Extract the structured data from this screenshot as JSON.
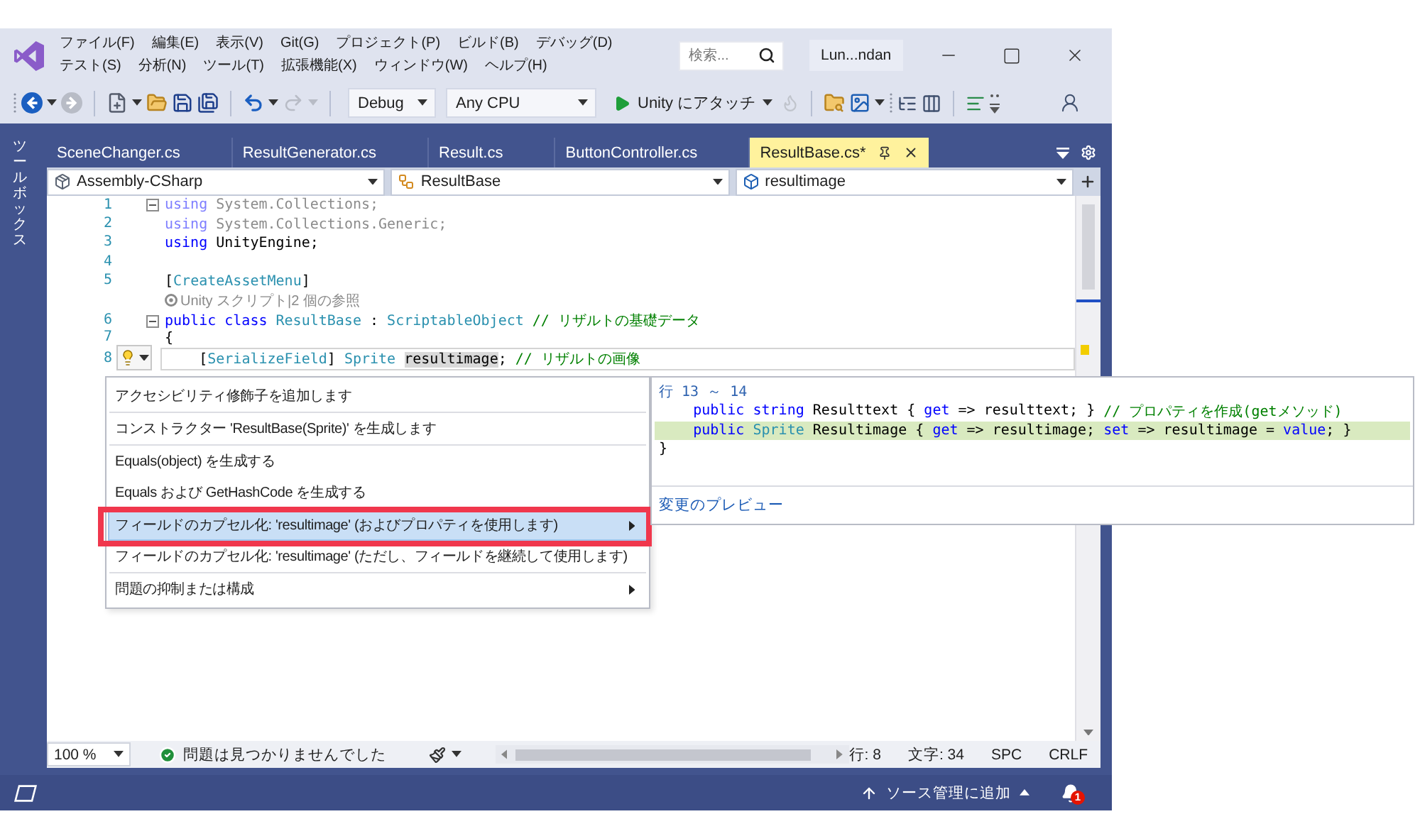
{
  "title_bar": {
    "menus": [
      [
        "ファイル(F)",
        "編集(E)",
        "表示(V)",
        "Git(G)",
        "プロジェクト(P)",
        "ビルド(B)",
        "デバッグ(D)"
      ],
      [
        "テスト(S)",
        "分析(N)",
        "ツール(T)",
        "拡張機能(X)",
        "ウィンドウ(W)",
        "ヘルプ(H)"
      ]
    ],
    "search": {
      "placeholder": "検索..."
    },
    "account": "Lun...ndan"
  },
  "toolbar": {
    "configuration": "Debug",
    "platform": "Any CPU",
    "start_label": "Unity にアタッチ"
  },
  "toolbox": {
    "label": "ツールボックス"
  },
  "tabs": [
    {
      "label": "SceneChanger.cs",
      "selected": false
    },
    {
      "label": "ResultGenerator.cs",
      "selected": false
    },
    {
      "label": "Result.cs",
      "selected": false
    },
    {
      "label": "ButtonController.cs",
      "selected": false
    },
    {
      "label": "ResultBase.cs*",
      "selected": true
    }
  ],
  "navigation_bar": [
    {
      "kind": "project",
      "label": "Assembly-CSharp"
    },
    {
      "kind": "class",
      "label": "ResultBase"
    },
    {
      "kind": "member",
      "label": "resultimage"
    }
  ],
  "editor": {
    "lines": [
      {
        "kind": "code",
        "number": "1",
        "expanded": true,
        "faded": true,
        "current": false,
        "lightbulb": false,
        "tokens": [
          {
            "kind": "keyword",
            "text": "using"
          },
          {
            "kind": "plain",
            "text": " System.Collections;"
          }
        ]
      },
      {
        "kind": "code",
        "number": "2",
        "faded": true,
        "current": false,
        "lightbulb": false,
        "tokens": [
          {
            "kind": "keyword",
            "text": "using"
          },
          {
            "kind": "plain",
            "text": " System.Collections.Generic;"
          }
        ]
      },
      {
        "kind": "code",
        "number": "3",
        "faded": false,
        "current": false,
        "lightbulb": false,
        "tokens": [
          {
            "kind": "keyword",
            "text": "using"
          },
          {
            "kind": "plain",
            "text": " UnityEngine;"
          }
        ]
      },
      {
        "kind": "code",
        "number": "4",
        "current": false,
        "lightbulb": false
      },
      {
        "kind": "code",
        "number": "5",
        "faded": false,
        "current": false,
        "lightbulb": false,
        "tokens": [
          {
            "kind": "plain",
            "text": "["
          },
          {
            "kind": "type",
            "text": "CreateAssetMenu"
          },
          {
            "kind": "plain",
            "text": "]"
          }
        ]
      },
      {
        "kind": "codelens",
        "text": "Unity スクリプト|2 個の参照"
      },
      {
        "kind": "code",
        "number": "6",
        "expanded": true,
        "faded": false,
        "current": false,
        "lightbulb": false,
        "tokens": [
          {
            "kind": "keyword",
            "text": "public"
          },
          {
            "kind": "keyword",
            "text": " class"
          },
          {
            "kind": "type",
            "text": " ResultBase"
          },
          {
            "kind": "plain",
            "text": " : "
          },
          {
            "kind": "type",
            "text": "ScriptableObject"
          },
          {
            "kind": "comment",
            "text": " // リザルトの基礎データ"
          }
        ]
      },
      {
        "kind": "code",
        "number": "7",
        "faded": false,
        "current": false,
        "lightbulb": false,
        "tokens": [
          {
            "kind": "plain",
            "text": "{"
          }
        ]
      },
      {
        "kind": "code",
        "number": "8",
        "faded": false,
        "current": true,
        "lightbulb": true,
        "tokens": [
          {
            "kind": "plain",
            "text": "    ["
          },
          {
            "kind": "type",
            "text": "SerializeField"
          },
          {
            "kind": "plain",
            "text": "]"
          },
          {
            "kind": "type",
            "text": " Sprite "
          },
          {
            "kind": "reference",
            "text": "resultimage"
          },
          {
            "kind": "plain",
            "text": ";"
          },
          {
            "kind": "comment",
            "text": " // リザルトの画像"
          }
        ]
      }
    ]
  },
  "quick_actions": {
    "groups": [
      [
        {
          "label": "アクセシビリティ修飾子を追加します",
          "selected": false,
          "submenu": false,
          "annotated": false
        }
      ],
      [
        {
          "label": "コンストラクター 'ResultBase(Sprite)' を生成します",
          "selected": false,
          "submenu": false,
          "annotated": false
        }
      ],
      [
        {
          "label": "Equals(object) を生成する",
          "selected": false,
          "submenu": false,
          "annotated": false
        },
        {
          "label": "Equals および GetHashCode を生成する",
          "selected": false,
          "submenu": false,
          "annotated": false
        }
      ],
      [
        {
          "label": "フィールドのカプセル化: 'resultimage' (およびプロパティを使用します)",
          "selected": true,
          "submenu": true,
          "annotated": true
        },
        {
          "label": "フィールドのカプセル化: 'resultimage' (ただし、フィールドを継続して使用します)",
          "selected": false,
          "submenu": false,
          "annotated": false
        }
      ],
      [
        {
          "label": "問題の抑制または構成",
          "selected": false,
          "submenu": true,
          "annotated": false
        }
      ]
    ]
  },
  "preview": {
    "header": "行 13 ～ 14",
    "lines": [
      {
        "added": false,
        "tokens": [
          {
            "kind": "keyword",
            "text": "    public"
          },
          {
            "kind": "keyword",
            "text": " string"
          },
          {
            "kind": "plain",
            "text": " Resulttext { "
          },
          {
            "kind": "keyword",
            "text": "get"
          },
          {
            "kind": "plain",
            "text": " => resulttext; }"
          },
          {
            "kind": "comment",
            "text": " // プロパティを作成(getメソッド)"
          }
        ]
      },
      {
        "added": true,
        "tokens": [
          {
            "kind": "keyword",
            "text": "    public"
          },
          {
            "kind": "type",
            "text": " Sprite"
          },
          {
            "kind": "plain",
            "text": " Resultimage { "
          },
          {
            "kind": "keyword",
            "text": "get"
          },
          {
            "kind": "plain",
            "text": " => resultimage; "
          },
          {
            "kind": "keyword",
            "text": "set"
          },
          {
            "kind": "plain",
            "text": " => resultimage = "
          },
          {
            "kind": "keyword",
            "text": "value"
          },
          {
            "kind": "plain",
            "text": "; }"
          }
        ]
      },
      {
        "added": false,
        "tokens": [
          {
            "kind": "plain",
            "text": "}"
          }
        ]
      }
    ],
    "link": "変更のプレビュー"
  },
  "editor_footer": {
    "zoom": "100 %",
    "issues": "問題は見つかりませんでした",
    "line": "行: 8",
    "column": "文字: 34",
    "whitespace": "SPC",
    "line_ending": "CRLF"
  },
  "status_bar": {
    "source_control": "ソース管理に追加",
    "notification_count": "1"
  }
}
